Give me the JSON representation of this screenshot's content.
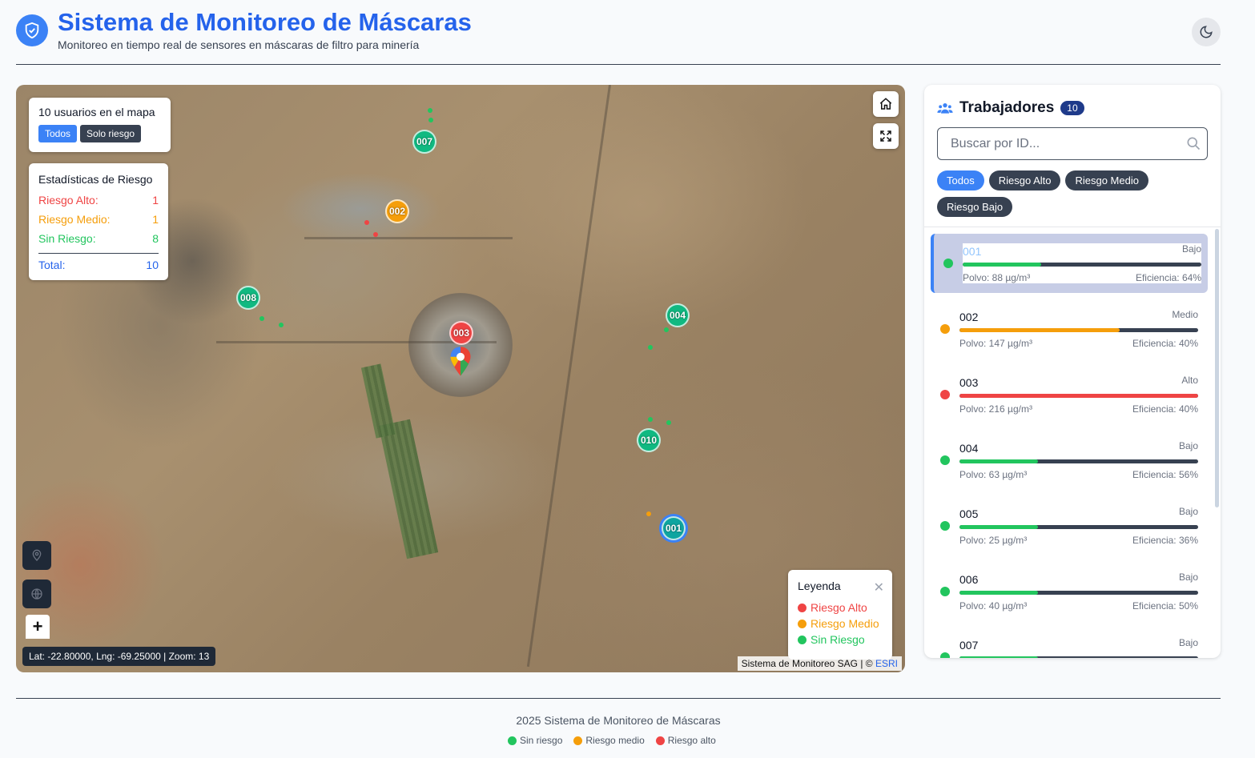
{
  "header": {
    "title": "Sistema de Monitoreo de Máscaras",
    "subtitle": "Monitoreo en tiempo real de sensores en máscaras de filtro para minería"
  },
  "colors": {
    "accent": "#3b82f6",
    "high": "#ef4444",
    "medium": "#f59e0b",
    "low": "#22c55e",
    "selected_marker": "#0ea5a0"
  },
  "map": {
    "users_label": "10 usuarios en el mapa",
    "filter_all": "Todos",
    "filter_risk": "Solo riesgo",
    "stats": {
      "title": "Estadísticas de Riesgo",
      "high_label": "Riesgo Alto:",
      "high_value": "1",
      "medium_label": "Riesgo Medio:",
      "medium_value": "1",
      "none_label": "Sin Riesgo:",
      "none_value": "8",
      "total_label": "Total:",
      "total_value": "10"
    },
    "coords": "Lat: -22.80000, Lng: -69.25000 | Zoom: 13",
    "attribution": "Sistema de Monitoreo SAG | ©",
    "attribution_link": "ESRI",
    "zoom_in": "+",
    "legend": {
      "title": "Leyenda",
      "high": "Riesgo Alto",
      "medium": "Riesgo Medio",
      "none": "Sin Riesgo"
    },
    "markers": [
      {
        "id": "007",
        "risk": "low"
      },
      {
        "id": "002",
        "risk": "medium"
      },
      {
        "id": "008",
        "risk": "low"
      },
      {
        "id": "003",
        "risk": "high"
      },
      {
        "id": "004",
        "risk": "low"
      },
      {
        "id": "010",
        "risk": "low"
      },
      {
        "id": "001",
        "risk": "low",
        "selected": true
      }
    ]
  },
  "sidebar": {
    "title": "Trabajadores",
    "count": "10",
    "search_placeholder": "Buscar por ID...",
    "filters": [
      "Todos",
      "Riesgo Alto",
      "Riesgo Medio",
      "Riesgo Bajo"
    ],
    "workers": [
      {
        "id": "001",
        "risk": "Bajo",
        "level": "low",
        "polvo": "Polvo: 88 µg/m³",
        "eficiencia": "Eficiencia: 64%",
        "fill": 0.33
      },
      {
        "id": "002",
        "risk": "Medio",
        "level": "medium",
        "polvo": "Polvo: 147 µg/m³",
        "eficiencia": "Eficiencia: 40%",
        "fill": 0.67
      },
      {
        "id": "003",
        "risk": "Alto",
        "level": "high",
        "polvo": "Polvo: 216 µg/m³",
        "eficiencia": "Eficiencia: 40%",
        "fill": 1.0
      },
      {
        "id": "004",
        "risk": "Bajo",
        "level": "low",
        "polvo": "Polvo: 63 µg/m³",
        "eficiencia": "Eficiencia: 56%",
        "fill": 0.33
      },
      {
        "id": "005",
        "risk": "Bajo",
        "level": "low",
        "polvo": "Polvo: 25 µg/m³",
        "eficiencia": "Eficiencia: 36%",
        "fill": 0.33
      },
      {
        "id": "006",
        "risk": "Bajo",
        "level": "low",
        "polvo": "Polvo: 40 µg/m³",
        "eficiencia": "Eficiencia: 50%",
        "fill": 0.33
      },
      {
        "id": "007",
        "risk": "Bajo",
        "level": "low",
        "polvo": "",
        "eficiencia": "",
        "fill": 0.33
      }
    ]
  },
  "footer": {
    "text": "2025 Sistema de Monitoreo de Máscaras",
    "legend_none": "Sin riesgo",
    "legend_medium": "Riesgo medio",
    "legend_high": "Riesgo alto"
  }
}
